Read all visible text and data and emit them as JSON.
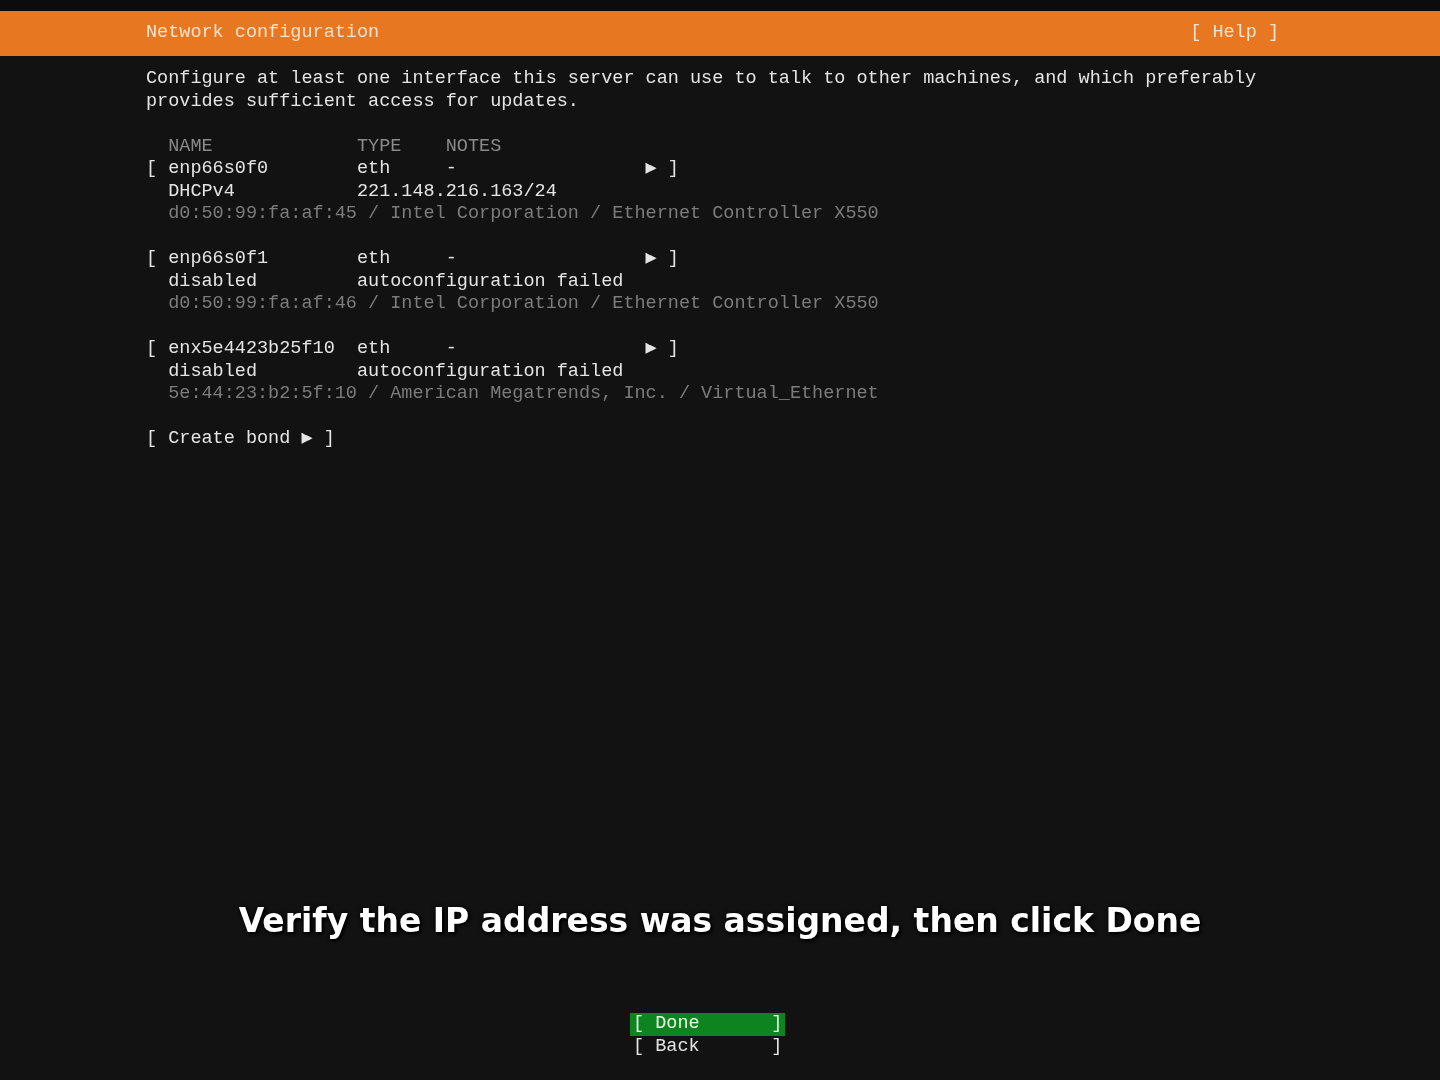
{
  "header": {
    "title": "Network configuration",
    "help": "[ Help ]"
  },
  "description": "Configure at least one interface this server can use to talk to other machines, and which preferably provides sufficient access for updates.",
  "table": {
    "columns": [
      "NAME",
      "TYPE",
      "NOTES"
    ],
    "rows": [
      {
        "open": "[",
        "name": "enp66s0f0",
        "type": "eth",
        "notes": "-",
        "close": "▶ ]",
        "status": "DHCPv4",
        "info": "221.148.216.163/24",
        "details": "d0:50:99:fa:af:45 / Intel Corporation / Ethernet Controller X550"
      },
      {
        "open": "[",
        "name": "enp66s0f1",
        "type": "eth",
        "notes": "-",
        "close": "▶ ]",
        "status": "disabled",
        "info": "autoconfiguration failed",
        "details": "d0:50:99:fa:af:46 / Intel Corporation / Ethernet Controller X550"
      },
      {
        "open": "[",
        "name": "enx5e4423b25f10",
        "type": "eth",
        "notes": "-",
        "close": "▶ ]",
        "status": "disabled",
        "info": "autoconfiguration failed",
        "details": "5e:44:23:b2:5f:10 / American Megatrends, Inc. / Virtual_Ethernet"
      }
    ]
  },
  "create_bond": {
    "open": "[",
    "label": "Create bond",
    "close": "▶ ]"
  },
  "caption": "Verify the IP address was assigned, then click Done",
  "buttons": [
    {
      "open": "[",
      "label": "Done",
      "close": "]",
      "selected": true
    },
    {
      "open": "[",
      "label": "Back",
      "close": "]",
      "selected": false
    }
  ]
}
